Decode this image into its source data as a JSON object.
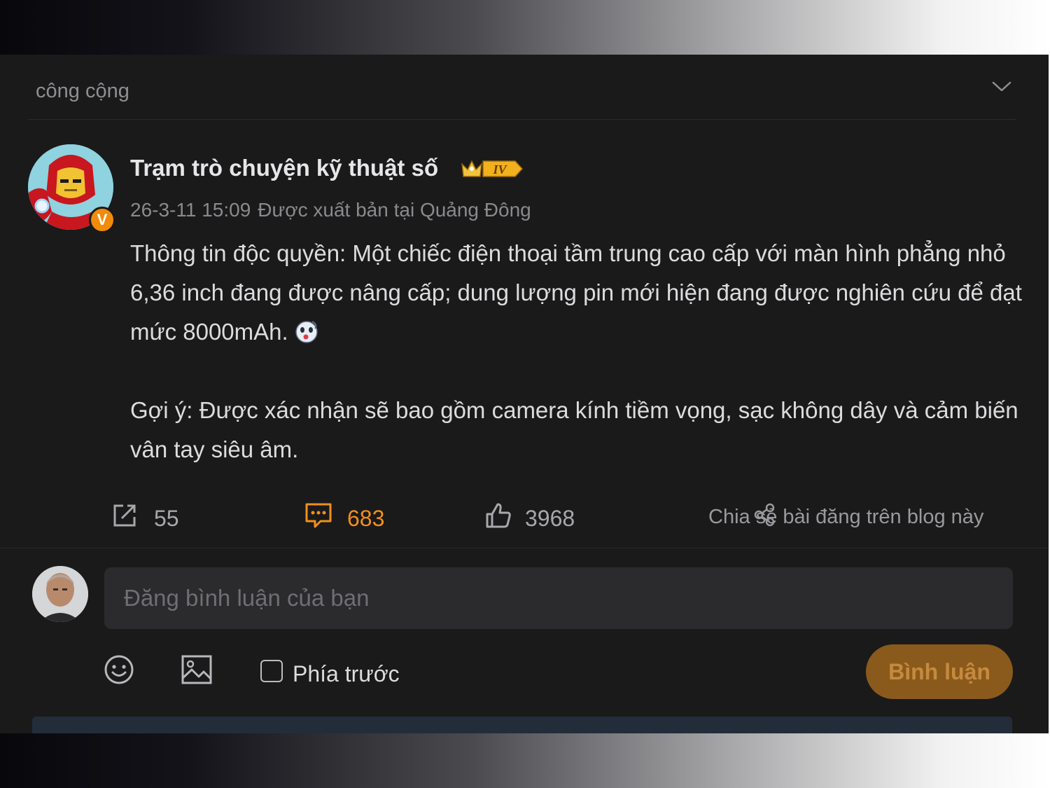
{
  "filter": {
    "label": "công cộng",
    "icon": "chevron-down-icon"
  },
  "post": {
    "author": "Trạm trò chuyện kỹ thuật số",
    "rank_badge": "IV",
    "verified_mark": "V",
    "timestamp": "26-3-11 15:09",
    "location": "Được xuất bản tại Quảng Đông",
    "paragraph1": "Thông tin độc quyền: Một chiếc điện thoại tầm trung cao cấp với màn hình phẳng nhỏ 6,36 inch đang được nâng cấp; dung lượng pin mới hiện đang được nghiên cứu để đạt mức 8000mAh.",
    "paragraph2": "Gợi ý: Được xác nhận sẽ bao gồm camera kính tiềm vọng, sạc không dây và cảm biến vân tay siêu âm."
  },
  "actions": {
    "shares": "55",
    "comments": "683",
    "likes": "3968",
    "blog_share": "Chia sẻ bài đăng trên blog này"
  },
  "composer": {
    "placeholder": "Đăng bình luận của bạn",
    "front_label": "Phía trước",
    "submit_label": "Bình luận"
  },
  "colors": {
    "panel_bg": "#1a1a1b",
    "accent": "#f0901a",
    "submit_bg": "#8a5a1c"
  }
}
